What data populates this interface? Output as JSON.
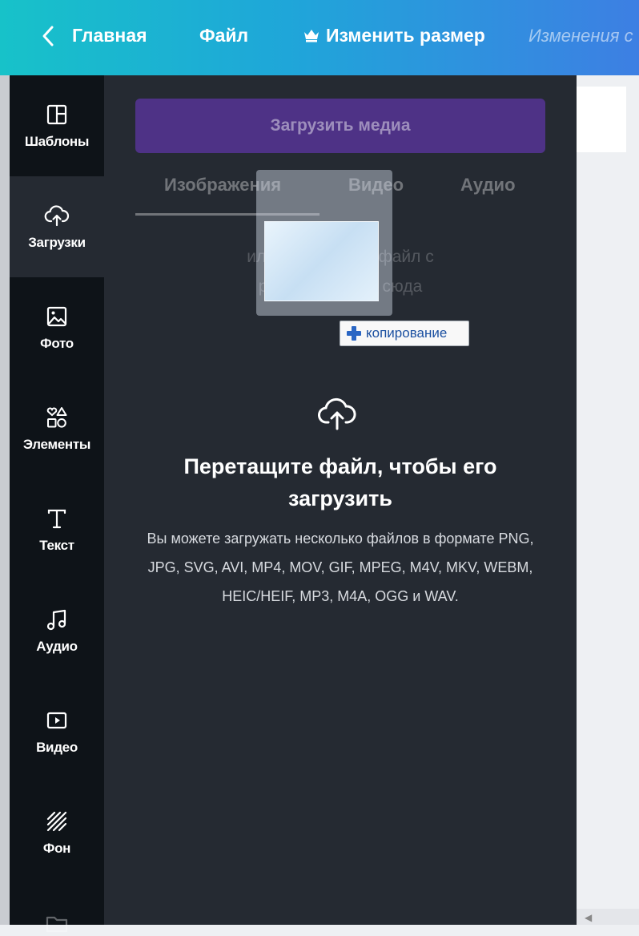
{
  "topbar": {
    "home_label": "Главная",
    "file_label": "Файл",
    "resize_label": "Изменить размер",
    "status_label": "Изменения с",
    "gradient_colors": [
      "#17c2c9",
      "#3d7fe3"
    ]
  },
  "sidebar": {
    "items": [
      {
        "label": "Шаблоны",
        "icon": "templates-icon"
      },
      {
        "label": "Загрузки",
        "icon": "upload-cloud-icon"
      },
      {
        "label": "Фото",
        "icon": "photo-icon"
      },
      {
        "label": "Элементы",
        "icon": "elements-icon"
      },
      {
        "label": "Текст",
        "icon": "text-icon"
      },
      {
        "label": "Аудио",
        "icon": "audio-icon"
      },
      {
        "label": "Видео",
        "icon": "video-icon"
      },
      {
        "label": "Фон",
        "icon": "background-icon"
      }
    ]
  },
  "panel": {
    "upload_button": "Загрузить медиа",
    "tabs": [
      "Изображения",
      "Видео",
      "Аудио"
    ],
    "hint_line1": "или перетащите файл с",
    "hint_line2": "рабочего стола сюда",
    "drag_tooltip": "копирование",
    "drop_title_line1": "Перетащите файл, чтобы его",
    "drop_title_line2": "загрузить",
    "drop_desc_line1": "Вы можете загружать несколько файлов в формате PNG,",
    "drop_desc_line2": "JPG, SVG, AVI, MP4, MOV, GIF, MPEG, M4V, MKV, WEBM,",
    "drop_desc_line3": "HEIC/HEIF, MP3, M4A, OGG и WAV.",
    "accent_color": "#4e3286"
  }
}
